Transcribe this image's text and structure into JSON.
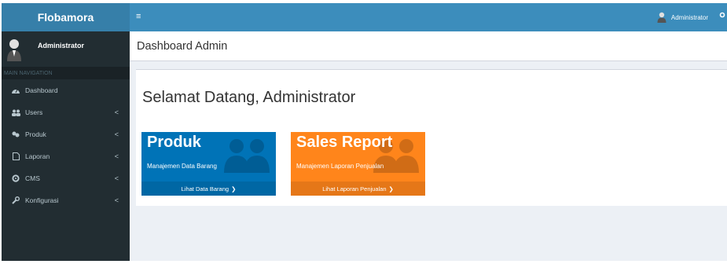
{
  "app": {
    "brand": "Flobamora"
  },
  "sidebar": {
    "user_name": "Administrator",
    "nav_header": "MAIN NAVIGATION",
    "items": [
      {
        "label": "Dashboard",
        "icon": "dashboard-icon",
        "has_submenu": false
      },
      {
        "label": "Users",
        "icon": "users-icon",
        "has_submenu": true
      },
      {
        "label": "Produk",
        "icon": "product-icon",
        "has_submenu": true
      },
      {
        "label": "Laporan",
        "icon": "report-icon",
        "has_submenu": true
      },
      {
        "label": "CMS",
        "icon": "cms-icon",
        "has_submenu": true
      },
      {
        "label": "Konfigurasi",
        "icon": "wrench-icon",
        "has_submenu": true
      }
    ],
    "chevron": "<"
  },
  "header": {
    "menu_toggle": "≡",
    "user_name": "Administrator"
  },
  "page": {
    "title": "Dashboard Admin",
    "welcome": "Selamat Datang, Administrator"
  },
  "tiles": [
    {
      "title": "Produk",
      "subtitle": "Manajemen Data Barang",
      "link": "Lihat Data Barang",
      "color": "#0073b7"
    },
    {
      "title": "Sales Report",
      "subtitle": "Manajemen Laporan Penjualan",
      "link": "Lihat Laporan Penjualan",
      "color": "#ff851b"
    }
  ],
  "colors": {
    "sidebar": "#222d32",
    "brand": "#367fa9",
    "topbar": "#3c8dbc",
    "content_bg": "#ecf0f5"
  }
}
